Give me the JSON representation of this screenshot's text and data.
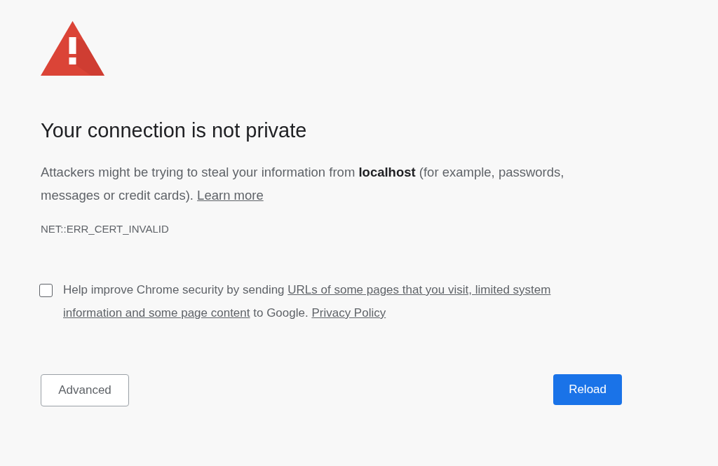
{
  "heading": "Your connection is not private",
  "message": {
    "text": "Attackers might be trying to steal your information from **localhost** (for example, passwords, messages or credit cards).",
    "link": "Learn more"
  },
  "error_code": "NET::ERR_CERT_INVALID",
  "consent": {
    "checked": false,
    "text_before": "Help improve Chrome security by sending",
    "link_lines": [
      "URLs of some pages that you visit, limited system",
      "information and some page content"
    ],
    "text_after": "to Google.",
    "privacy_link": "Privacy Policy"
  },
  "buttons": [
    {
      "kind": "secondary",
      "label": "Advanced"
    },
    {
      "kind": "primary",
      "label": "Reload"
    }
  ]
}
